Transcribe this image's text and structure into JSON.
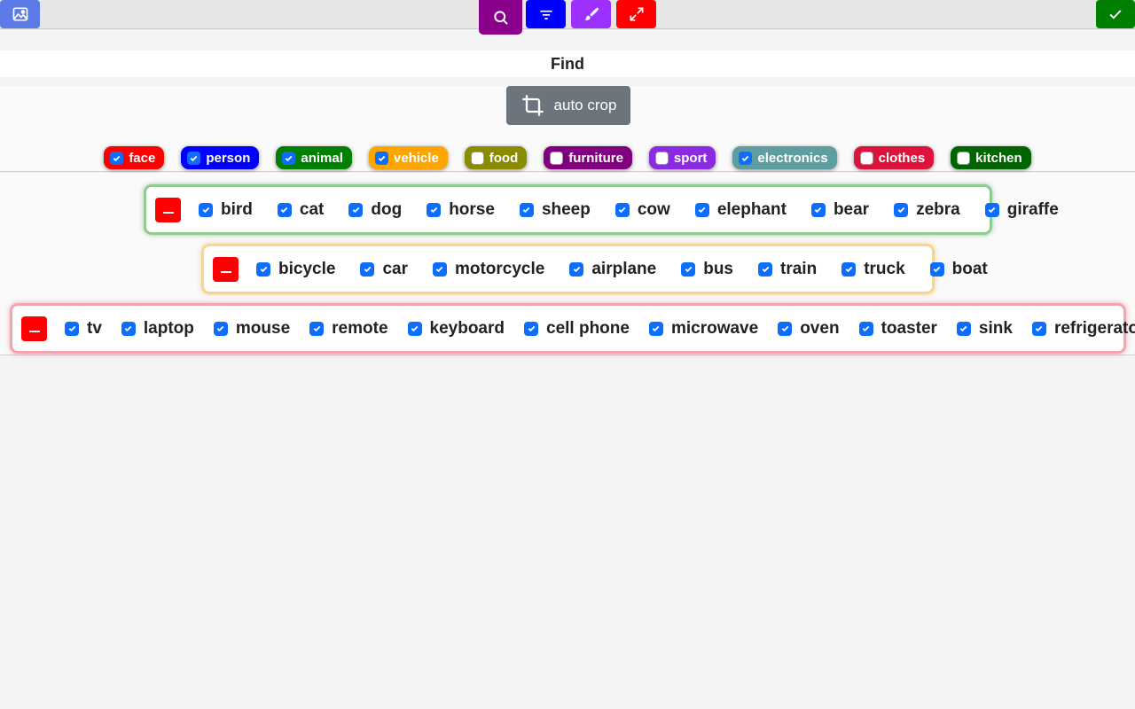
{
  "toolbar": {
    "buttons": [
      {
        "name": "image",
        "icon": "image-icon",
        "color": "#5b7ce6"
      },
      {
        "name": "find",
        "icon": "search-icon",
        "color": "#8b008b"
      },
      {
        "name": "filter",
        "icon": "filter-icon",
        "color": "#0000ff"
      },
      {
        "name": "brush",
        "icon": "brush-icon",
        "color": "#9b30ff"
      },
      {
        "name": "expand",
        "icon": "expand-icon",
        "color": "#ff0000"
      },
      {
        "name": "done",
        "icon": "check-icon",
        "color": "#008000"
      }
    ]
  },
  "find_title": "Find",
  "auto_crop_label": "auto crop",
  "categories": [
    {
      "label": "face",
      "checked": true,
      "color": "#ff0000"
    },
    {
      "label": "person",
      "checked": true,
      "color": "#0000ff"
    },
    {
      "label": "animal",
      "checked": true,
      "color": "#008000"
    },
    {
      "label": "vehicle",
      "checked": true,
      "color": "#ffa500"
    },
    {
      "label": "food",
      "checked": false,
      "color": "#8b8b00"
    },
    {
      "label": "furniture",
      "checked": false,
      "color": "#800080"
    },
    {
      "label": "sport",
      "checked": false,
      "color": "#8a2be2"
    },
    {
      "label": "electronics",
      "checked": true,
      "color": "#5f9ea0"
    },
    {
      "label": "clothes",
      "checked": false,
      "color": "#dc143c"
    },
    {
      "label": "kitchen",
      "checked": false,
      "color": "#006400"
    }
  ],
  "groups": [
    {
      "id": "animal",
      "items": [
        "bird",
        "cat",
        "dog",
        "horse",
        "sheep",
        "cow",
        "elephant",
        "bear",
        "zebra",
        "giraffe"
      ]
    },
    {
      "id": "vehicle",
      "items": [
        "bicycle",
        "car",
        "motorcycle",
        "airplane",
        "bus",
        "train",
        "truck",
        "boat"
      ]
    },
    {
      "id": "electronics",
      "items": [
        "tv",
        "laptop",
        "mouse",
        "remote",
        "keyboard",
        "cell phone",
        "microwave",
        "oven",
        "toaster",
        "sink",
        "refrigerator"
      ]
    }
  ]
}
